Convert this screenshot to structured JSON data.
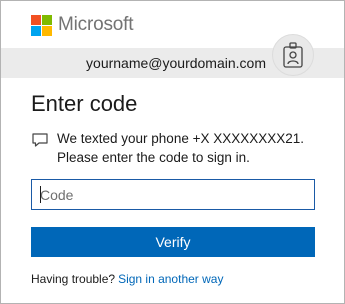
{
  "brand": {
    "name": "Microsoft",
    "logo_colors": [
      "#f25022",
      "#7fba00",
      "#00a4ef",
      "#ffb900"
    ]
  },
  "account": {
    "email": "yourname@yourdomain.com",
    "badge_icon": "badge-id-icon"
  },
  "page": {
    "title": "Enter code"
  },
  "message": {
    "icon": "sms-message-icon",
    "line1": "We texted your phone +X XXXXXXXX21.",
    "line2": "Please enter the code to sign in."
  },
  "code_input": {
    "placeholder": "Code",
    "value": ""
  },
  "verify_button": {
    "label": "Verify",
    "color": "#0067b8"
  },
  "help": {
    "prompt": "Having trouble?",
    "link": "Sign in another way"
  }
}
